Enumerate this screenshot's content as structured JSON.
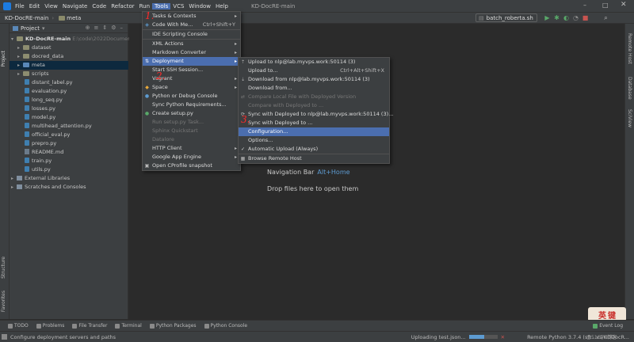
{
  "menubar": {
    "items": [
      "File",
      "Edit",
      "View",
      "Navigate",
      "Code",
      "Refactor",
      "Run",
      "Tools",
      "VCS",
      "Window",
      "Help"
    ],
    "active": "Tools",
    "window_title": "KD-DocRE-main"
  },
  "toolbar": {
    "breadcrumb_project": "KD-DocRE-main",
    "breadcrumb_folder": "meta",
    "run_config": "batch_roberta.sh"
  },
  "project_panel": {
    "header": "Project",
    "root_name": "KD-DocRE-main",
    "root_path": "E:\\code\\2022Document...",
    "folders": [
      "dataset",
      "docred_data",
      "meta",
      "scripts"
    ],
    "files": [
      "distant_label.py",
      "evaluation.py",
      "long_seq.py",
      "losses.py",
      "model.py",
      "multihead_attention.py",
      "official_eval.py",
      "prepro.py",
      "README.md",
      "train.py",
      "utils.py"
    ],
    "external": "External Libraries",
    "scratches": "Scratches and Consoles"
  },
  "left_strip": {
    "project": "Project",
    "structure": "Structure",
    "favorites": "Favorites"
  },
  "right_strip": {
    "remote_host": "Remote Host",
    "database": "Database",
    "sciview": "SciView"
  },
  "editor": {
    "nav_label": "Navigation Bar",
    "nav_shortcut": "Alt+Home",
    "drop_hint": "Drop files here to open them"
  },
  "tools_menu": {
    "items": [
      {
        "label": "Tasks & Contexts",
        "sub": true
      },
      {
        "label": "Code With Me...",
        "shortcut": "Ctrl+Shift+Y"
      },
      {
        "sep": true
      },
      {
        "label": "IDE Scripting Console"
      },
      {
        "sep": true
      },
      {
        "label": "XML Actions",
        "sub": true
      },
      {
        "label": "Markdown Converter",
        "sub": true
      },
      {
        "label": "Deployment",
        "sub": true,
        "highlight": true
      },
      {
        "label": "Start SSH Session..."
      },
      {
        "label": "Vagrant",
        "sub": true
      },
      {
        "label": "Space",
        "sub": true
      },
      {
        "label": "Python or Debug Console"
      },
      {
        "label": "Sync Python Requirements..."
      },
      {
        "label": "Create setup.py"
      },
      {
        "label": "Run setup.py Task...",
        "disabled": true
      },
      {
        "label": "Sphinx Quickstart",
        "disabled": true
      },
      {
        "label": "Datalore",
        "disabled": true
      },
      {
        "label": "HTTP Client",
        "sub": true
      },
      {
        "label": "Google App Engine",
        "sub": true
      },
      {
        "label": "Open CProfile snapshot"
      }
    ]
  },
  "deployment_menu": {
    "items": [
      {
        "label": "Upload to nlp@lab.myvps.work:50114 (3)"
      },
      {
        "label": "Upload to...",
        "shortcut": "Ctrl+Alt+Shift+X"
      },
      {
        "label": "Download from nlp@lab.myvps.work:50114 (3)"
      },
      {
        "label": "Download from..."
      },
      {
        "label": "Compare Local File with Deployed Version",
        "disabled": true
      },
      {
        "label": "Compare with Deployed to ...",
        "disabled": true
      },
      {
        "label": "Sync with Deployed to nlp@lab.myvps.work:50114 (3)..."
      },
      {
        "label": "Sync with Deployed to ..."
      },
      {
        "label": "Configuration...",
        "highlight": true
      },
      {
        "label": "Options..."
      },
      {
        "label": "Automatic Upload (Always)",
        "check": true
      },
      {
        "sep": true
      },
      {
        "label": "Browse Remote Host"
      }
    ]
  },
  "bottom_tools": [
    "TODO",
    "Problems",
    "File Transfer",
    "Terminal",
    "Python Packages",
    "Python Console"
  ],
  "event_log": "Event Log",
  "status": {
    "message": "Configure deployment servers and paths",
    "upload": "Uploading test.json...",
    "interpreter": "Remote Python 3.7.4 (sft...vs/KDDocR...",
    "watermark_overlay": "@51CTO博客"
  },
  "annotations": {
    "a1": "1.",
    "a2": "2.",
    "a3": "3."
  },
  "watermark": {
    "chars": [
      "英",
      "键"
    ]
  },
  "colors": {
    "accent": "#4b6eaf",
    "selection": "#0d293e",
    "annotation": "#ff2a2a"
  }
}
